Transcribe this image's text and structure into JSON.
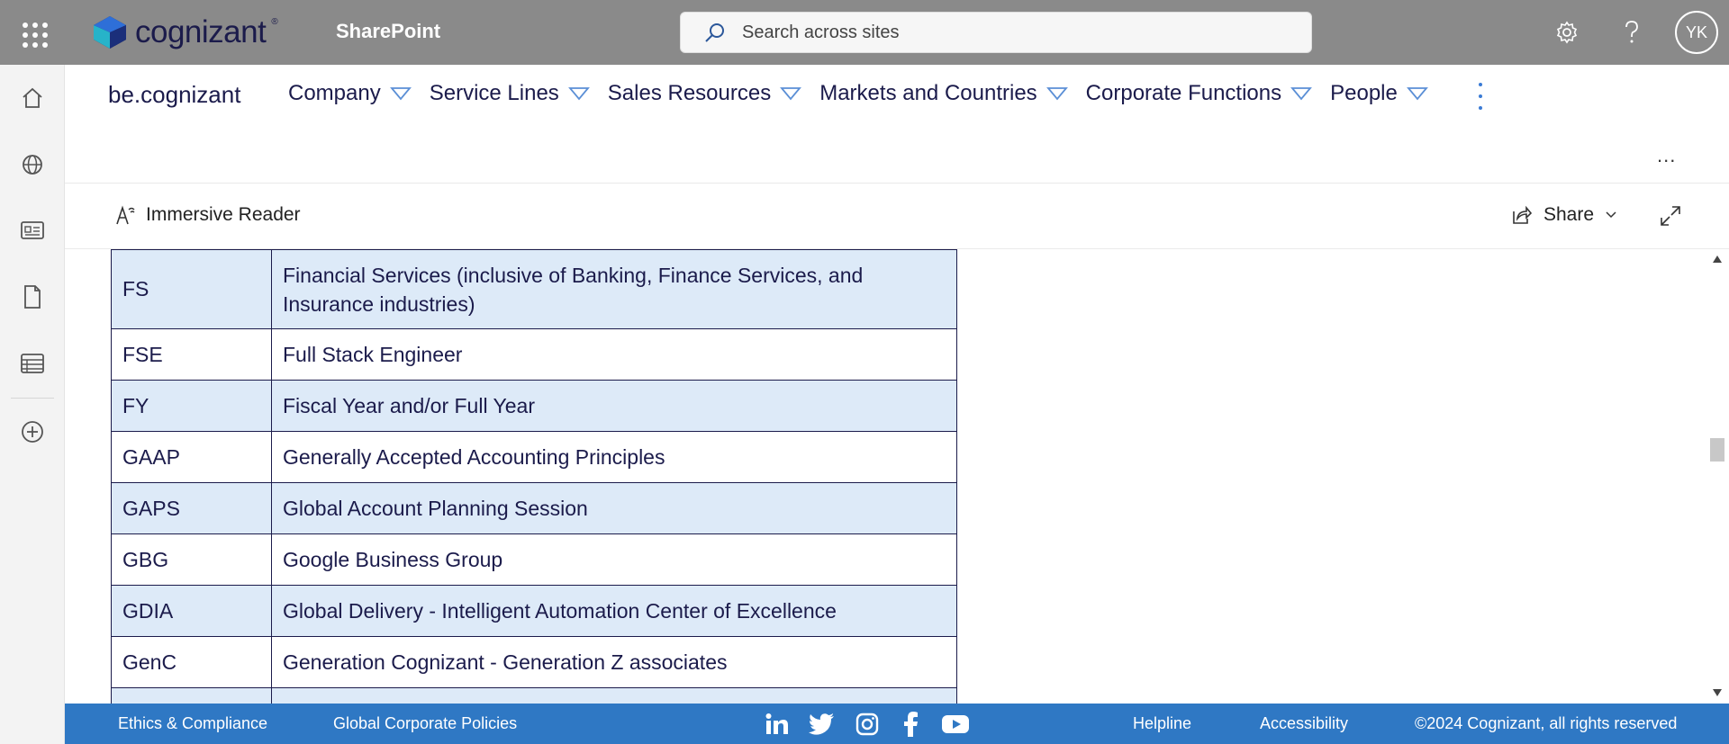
{
  "suitebar": {
    "logo_text": "cognizant",
    "logo_tm": "®",
    "app_title": "SharePoint",
    "search_placeholder": "Search across sites",
    "avatar_initials": "YK"
  },
  "site": {
    "name": "be.cognizant",
    "nav": [
      {
        "label": "Company"
      },
      {
        "label": "Service Lines"
      },
      {
        "label": "Sales Resources"
      },
      {
        "label": "Markets and Countries"
      },
      {
        "label": "Corporate Functions"
      },
      {
        "label": "People"
      }
    ],
    "more": "..."
  },
  "commandbar": {
    "immersive_reader": "Immersive Reader",
    "share": "Share"
  },
  "table": {
    "rows": [
      {
        "abbr": "FS",
        "desc": "Financial Services (inclusive of Banking, Finance Services, and Insurance industries)"
      },
      {
        "abbr": "FSE",
        "desc": "Full Stack Engineer"
      },
      {
        "abbr": "FY",
        "desc": "Fiscal Year and/or Full Year"
      },
      {
        "abbr": "GAAP",
        "desc": "Generally Accepted Accounting Principles"
      },
      {
        "abbr": "GAPS",
        "desc": "Global Account Planning Session"
      },
      {
        "abbr": "GBG",
        "desc": "Google Business Group"
      },
      {
        "abbr": "GDIA",
        "desc": "Global Delivery - Intelligent Automation Center of Excellence"
      },
      {
        "abbr": "GenC",
        "desc": "Generation Cognizant - Generation Z associates"
      },
      {
        "abbr": "",
        "desc": ""
      }
    ]
  },
  "footer": {
    "ethics": "Ethics & Compliance",
    "policies": "Global Corporate Policies",
    "helpline": "Helpline",
    "accessibility": "Accessibility",
    "copyright": "©2024 Cognizant, all rights reserved"
  },
  "colors": {
    "suitebar": "#8a8a8a",
    "footer": "#2f78c4",
    "row_alt": "#ddeaf8",
    "text": "#1b1b4b"
  }
}
